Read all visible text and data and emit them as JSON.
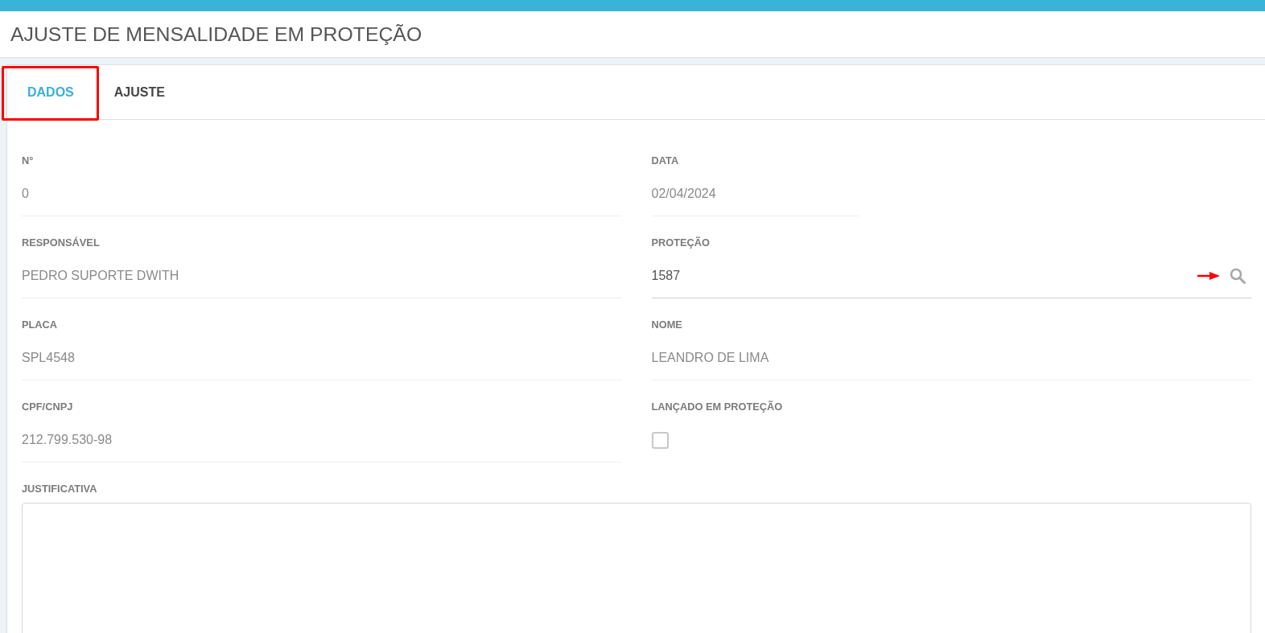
{
  "header": {
    "title": "AJUSTE DE MENSALIDADE EM PROTEÇÃO"
  },
  "tabs": [
    {
      "label": "DADOS",
      "selected": true
    },
    {
      "label": "AJUSTE",
      "selected": false
    }
  ],
  "annotations": {
    "tab_highlight": true,
    "search_arrow": true
  },
  "form": {
    "fields": [
      {
        "kind": "text",
        "label": "N°",
        "value": "0"
      },
      {
        "kind": "date",
        "label": "DATA",
        "value": "02/04/2024"
      },
      {
        "kind": "text",
        "label": "RESPONSÁVEL",
        "value": "PEDRO SUPORTE DWITH"
      },
      {
        "kind": "lookup",
        "label": "PROTEÇÃO",
        "value": "1587"
      },
      {
        "kind": "text",
        "label": "PLACA",
        "value": "SPL4548"
      },
      {
        "kind": "text",
        "label": "NOME",
        "value": "LEANDRO DE LIMA"
      },
      {
        "kind": "text",
        "label": "CPF/CNPJ",
        "value": "212.799.530-98"
      },
      {
        "kind": "checkbox",
        "label": "LANÇADO EM PROTEÇÃO",
        "checked": false
      },
      {
        "kind": "textarea",
        "label": "JUSTIFICATIVA"
      }
    ]
  }
}
